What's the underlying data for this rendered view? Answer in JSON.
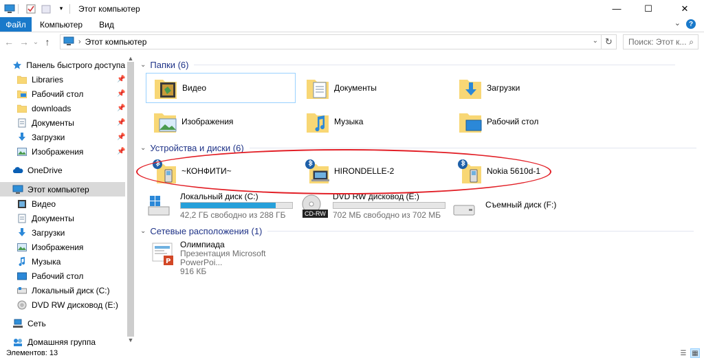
{
  "window": {
    "title": "Этот компьютер",
    "controls": {
      "minimize": "—",
      "maximize": "☐",
      "close": "✕"
    }
  },
  "ribbon": {
    "tabs": [
      "Файл",
      "Компьютер",
      "Вид"
    ],
    "help": "?",
    "collapse": "⌄"
  },
  "nav": {
    "back": "←",
    "forward": "→",
    "recent": "⌄",
    "up": "↑",
    "breadcrumb": "Этот компьютер",
    "refresh": "↻",
    "search_placeholder": "Поиск: Этот к...",
    "search_icon": "⌕"
  },
  "sidebar": {
    "items": [
      {
        "label": "Панель быстрого доступа",
        "icon": "star-icon",
        "pinned": false
      },
      {
        "label": "Libraries",
        "icon": "folder-icon",
        "pinned": true
      },
      {
        "label": "Рабочий стол",
        "icon": "desktop-folder-icon",
        "pinned": true
      },
      {
        "label": "downloads",
        "icon": "folder-icon",
        "pinned": true
      },
      {
        "label": "Документы",
        "icon": "documents-icon",
        "pinned": true
      },
      {
        "label": "Загрузки",
        "icon": "download-icon",
        "pinned": true
      },
      {
        "label": "Изображения",
        "icon": "pictures-icon",
        "pinned": true
      },
      {
        "label": "OneDrive",
        "icon": "cloud-icon",
        "pinned": false
      },
      {
        "label": "Этот компьютер",
        "icon": "computer-icon",
        "pinned": false
      },
      {
        "label": "Видео",
        "icon": "video-icon",
        "pinned": false
      },
      {
        "label": "Документы",
        "icon": "documents-icon",
        "pinned": false
      },
      {
        "label": "Загрузки",
        "icon": "download-icon",
        "pinned": false
      },
      {
        "label": "Изображения",
        "icon": "pictures-icon",
        "pinned": false
      },
      {
        "label": "Музыка",
        "icon": "music-icon",
        "pinned": false
      },
      {
        "label": "Рабочий стол",
        "icon": "desktop-folder-icon",
        "pinned": false
      },
      {
        "label": "Локальный диск (C:)",
        "icon": "drive-icon",
        "pinned": false
      },
      {
        "label": "DVD RW дисковод (E:)",
        "icon": "dvd-icon",
        "pinned": false
      },
      {
        "label": "Сеть",
        "icon": "network-icon",
        "pinned": false
      },
      {
        "label": "Домашняя группа",
        "icon": "homegroup-icon",
        "pinned": false
      }
    ],
    "pin_glyph": "📌"
  },
  "groups": {
    "folders": {
      "title": "Папки (6)",
      "items": [
        {
          "label": "Видео",
          "icon": "video-folder-icon"
        },
        {
          "label": "Документы",
          "icon": "documents-folder-icon"
        },
        {
          "label": "Загрузки",
          "icon": "downloads-folder-icon"
        },
        {
          "label": "Изображения",
          "icon": "pictures-folder-icon"
        },
        {
          "label": "Музыка",
          "icon": "music-folder-icon"
        },
        {
          "label": "Рабочий стол",
          "icon": "desktop-folder-icon"
        }
      ]
    },
    "devices": {
      "title": "Устройства и диски (6)",
      "bluetooth": [
        {
          "label": "~КОНФИТИ~",
          "icon": "bluetooth-phone-icon"
        },
        {
          "label": "HIRONDELLE-2",
          "icon": "bluetooth-laptop-icon"
        },
        {
          "label": "Nokia 5610d-1",
          "icon": "bluetooth-phone-icon"
        }
      ],
      "drives": [
        {
          "name": "Локальный диск (C:)",
          "free": "42,2 ГБ свободно из 288 ГБ",
          "used_fraction": 0.85,
          "icon": "windows-drive-icon"
        },
        {
          "name": "DVD RW дисковод (E:)",
          "free": "702 МБ свободно из 702 МБ",
          "used_fraction": 0.0,
          "icon": "cd-rw-icon",
          "badge": "CD-RW"
        },
        {
          "name": "Съемный диск (F:)",
          "free": "",
          "used_fraction": null,
          "icon": "removable-drive-icon"
        }
      ]
    },
    "network": {
      "title": "Сетевые расположения (1)",
      "items": [
        {
          "name": "Олимпиада",
          "type": "Презентация Microsoft PowerPoi...",
          "size": "916 КБ",
          "icon": "powerpoint-file-icon"
        }
      ]
    }
  },
  "status": {
    "items": "Элементов: 13"
  },
  "colors": {
    "accent": "#1979ca",
    "group_title": "#1e3287",
    "annotation": "#e21f26",
    "drive_bar": "#26a0da"
  }
}
